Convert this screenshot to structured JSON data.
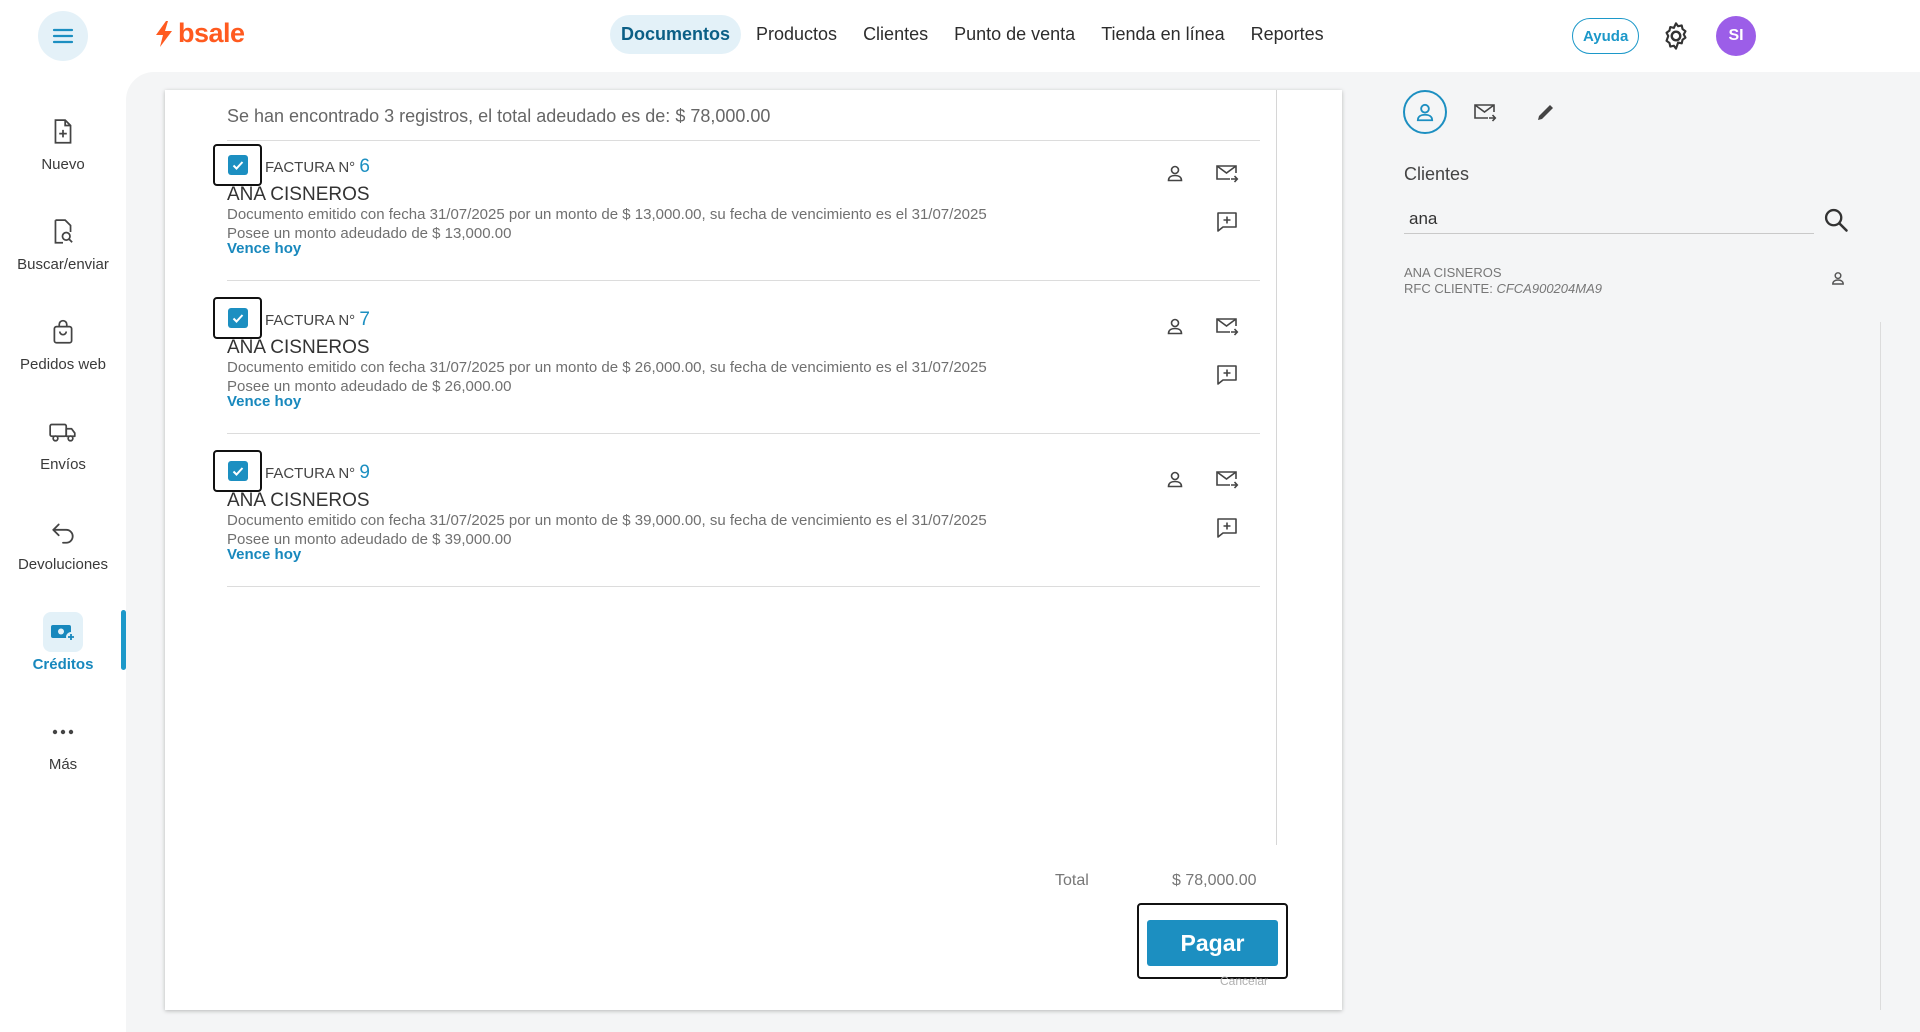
{
  "topbar": {
    "brand": "bsale",
    "nav": [
      "Documentos",
      "Productos",
      "Clientes",
      "Punto de venta",
      "Tienda en línea",
      "Reportes"
    ],
    "help_label": "Ayuda",
    "avatar_initials": "SI"
  },
  "sidebar": {
    "items": [
      {
        "label": "Nuevo",
        "icon": "new-document-icon"
      },
      {
        "label": "Buscar/enviar",
        "icon": "search-document-icon"
      },
      {
        "label": "Pedidos web",
        "icon": "shopping-bag-icon"
      },
      {
        "label": "Envíos",
        "icon": "truck-icon"
      },
      {
        "label": "Devoluciones",
        "icon": "return-arrow-icon"
      },
      {
        "label": "Créditos",
        "icon": "credits-icon",
        "active": true
      },
      {
        "label": "Más",
        "icon": "more-icon"
      }
    ]
  },
  "main": {
    "summary": "Se han encontrado 3 registros, el total adeudado es de: $ 78,000.00",
    "invoices": [
      {
        "title": "FACTURA N°",
        "number": "6",
        "client": "ANA CISNEROS",
        "detail": "Documento emitido con fecha 31/07/2025 por un monto de $ 13,000.00, su fecha de vencimiento es el 31/07/2025",
        "owed": "Posee un monto adeudado de $ 13,000.00",
        "due": "Vence hoy",
        "checked": true
      },
      {
        "title": "FACTURA N°",
        "number": "7",
        "client": "ANA CISNEROS",
        "detail": "Documento emitido con fecha 31/07/2025 por un monto de $ 26,000.00, su fecha de vencimiento es el 31/07/2025",
        "owed": "Posee un monto adeudado de $ 26,000.00",
        "due": "Vence hoy",
        "checked": true
      },
      {
        "title": "FACTURA N°",
        "number": "9",
        "client": "ANA CISNEROS",
        "detail": "Documento emitido con fecha 31/07/2025 por un monto de $ 39,000.00, su fecha de vencimiento es el 31/07/2025",
        "owed": "Posee un monto adeudado de $ 39,000.00",
        "due": "Vence hoy",
        "checked": true
      }
    ],
    "total_label": "Total",
    "total_value": "$ 78,000.00",
    "pay_label": "Pagar",
    "cancel_label": "Cancelar"
  },
  "right_panel": {
    "title": "Clientes",
    "search_value": "ana",
    "result": {
      "name": "ANA CISNEROS",
      "rfc_label": "RFC CLIENTE:",
      "rfc_value": "CFCA900204MA9"
    }
  },
  "colors": {
    "accent": "#1c8fc1",
    "brand": "#ff5a1f",
    "avatar": "#9c5ee8"
  }
}
